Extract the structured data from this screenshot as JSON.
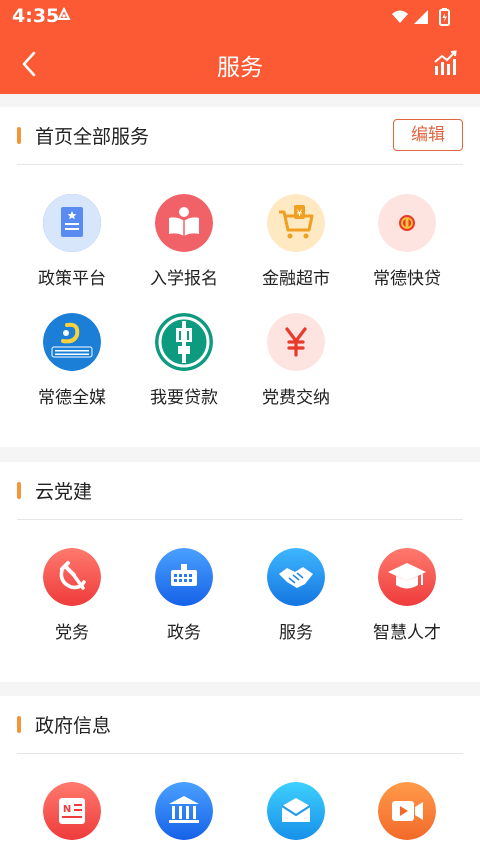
{
  "status_bar": {
    "time": "4:35"
  },
  "header": {
    "title": "服务"
  },
  "sections": {
    "home": {
      "title": "首页全部服务",
      "edit_label": "编辑",
      "items": [
        {
          "label": "政策平台",
          "icon": "policy-document-icon"
        },
        {
          "label": "入学报名",
          "icon": "open-book-icon"
        },
        {
          "label": "金融超市",
          "icon": "shopping-cart-icon"
        },
        {
          "label": "常德快贷",
          "icon": "coin-badge-icon"
        },
        {
          "label": "常德全媒",
          "icon": "changde-media-logo-icon"
        },
        {
          "label": "我要贷款",
          "icon": "agricultural-bank-logo-icon"
        },
        {
          "label": "党费交纳",
          "icon": "yuan-icon"
        }
      ]
    },
    "party": {
      "title": "云党建",
      "items": [
        {
          "label": "党务",
          "icon": "hammer-sickle-icon"
        },
        {
          "label": "政务",
          "icon": "government-building-icon"
        },
        {
          "label": "服务",
          "icon": "handshake-icon"
        },
        {
          "label": "智慧人才",
          "icon": "graduation-cap-icon"
        }
      ]
    },
    "gov": {
      "title": "政府信息",
      "items": [
        {
          "icon": "news-icon"
        },
        {
          "icon": "institution-icon"
        },
        {
          "icon": "mail-icon"
        },
        {
          "icon": "video-icon"
        }
      ]
    }
  },
  "colors": {
    "brand": "#fb5a35",
    "accent_bar": "#f5953a",
    "edit_border": "#e06640"
  }
}
